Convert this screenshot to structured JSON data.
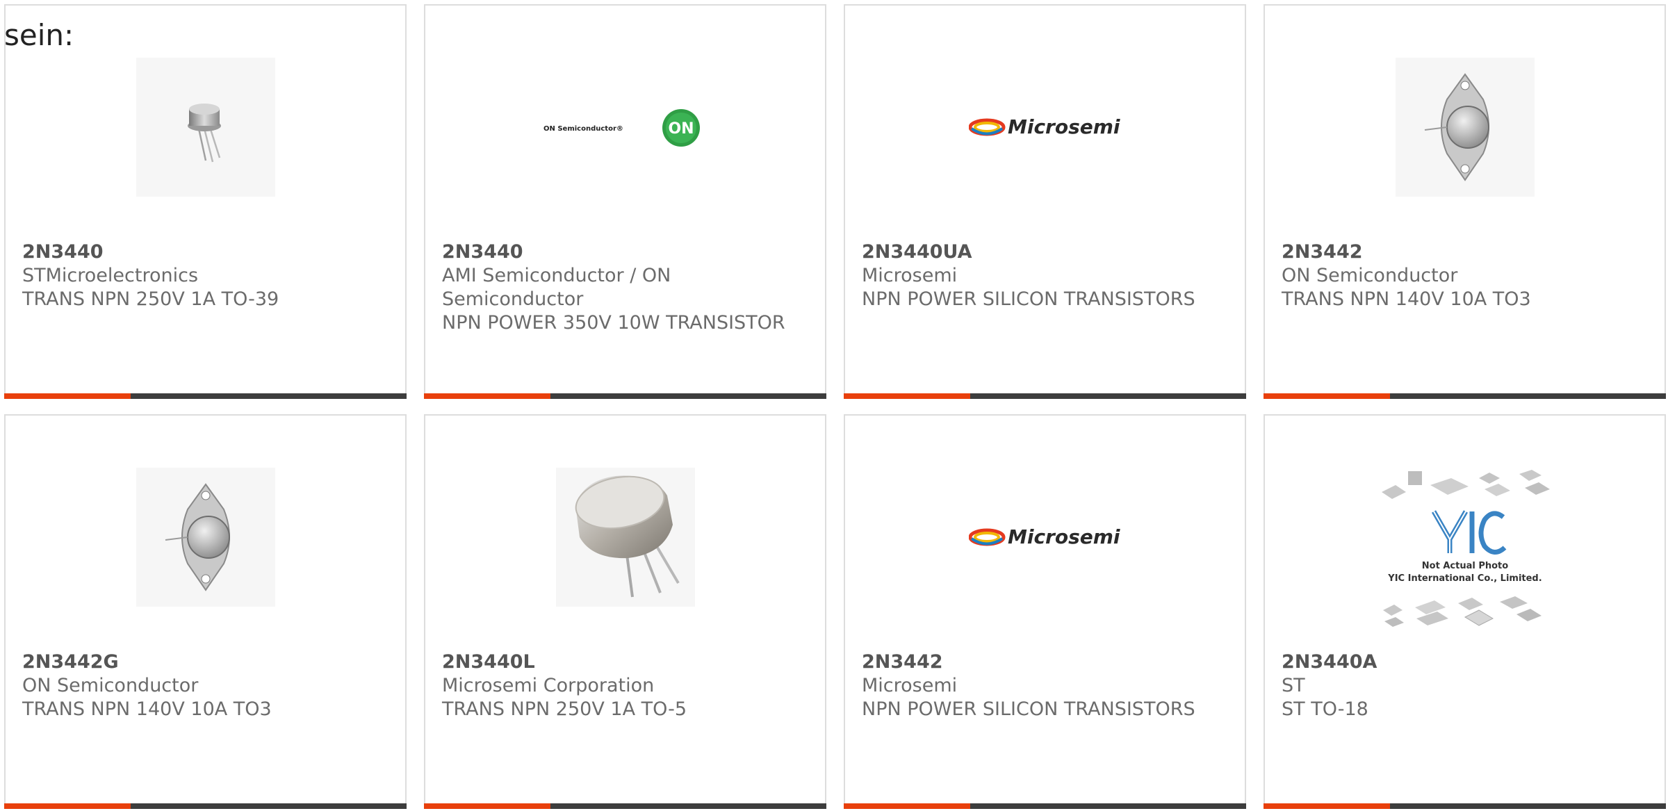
{
  "intro_text": "sein:",
  "colors": {
    "accent": "#e8400c",
    "bar": "#3d3d3d",
    "border": "#dddddd",
    "text": "#6b6b6b"
  },
  "products": [
    {
      "part": "2N3440",
      "manufacturer": "STMicroelectronics",
      "description": "TRANS NPN 250V 1A TO-39",
      "image": "small-to39-transistor-photo"
    },
    {
      "part": "2N3440",
      "manufacturer": "AMI Semiconductor / ON Semiconductor",
      "description": "NPN POWER 350V 10W TRANSISTOR",
      "image": "on-semiconductor-logo",
      "logo_text": "ON Semiconductor®",
      "logo_badge": "ON"
    },
    {
      "part": "2N3440UA",
      "manufacturer": "Microsemi",
      "description": "NPN POWER SILICON TRANSISTORS",
      "image": "microsemi-logo",
      "logo_text": "Microsemi"
    },
    {
      "part": "2N3442",
      "manufacturer": "ON Semiconductor",
      "description": "TRANS NPN 140V 10A TO3",
      "image": "to3-transistor-photo"
    },
    {
      "part": "2N3442G",
      "manufacturer": "ON Semiconductor",
      "description": "TRANS NPN 140V 10A TO3",
      "image": "to3-transistor-photo"
    },
    {
      "part": "2N3440L",
      "manufacturer": "Microsemi Corporation",
      "description": "TRANS NPN 250V 1A TO-5",
      "image": "large-to5-transistor-photo"
    },
    {
      "part": "2N3442",
      "manufacturer": "Microsemi",
      "description": "NPN POWER SILICON TRANSISTORS",
      "image": "microsemi-logo",
      "logo_text": "Microsemi"
    },
    {
      "part": "2N3440A",
      "manufacturer": "ST",
      "description": "ST TO-18",
      "image": "yic-not-actual-photo",
      "logo_text": "YIC",
      "caption_line1": "Not Actual Photo",
      "caption_line2": "YIC International Co., Limited."
    }
  ]
}
